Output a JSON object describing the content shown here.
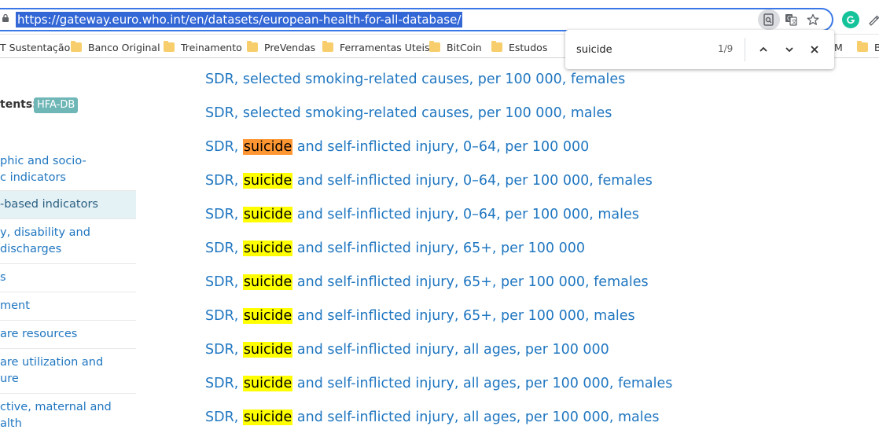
{
  "browser": {
    "url": "https://gateway.euro.who.int/en/datasets/european-health-for-all-database/",
    "icons": [
      "lock-icon",
      "find-in-page-icon",
      "translate-icon",
      "star-icon",
      "grammarly-icon",
      "extension-icon"
    ]
  },
  "bookmarks": [
    {
      "label": "T Sustentação"
    },
    {
      "label": "Banco Original"
    },
    {
      "label": "Treinamento"
    },
    {
      "label": "PreVendas"
    },
    {
      "label": "Ferramentas Uteis"
    },
    {
      "label": "BitCoin"
    },
    {
      "label": "Estudos"
    },
    {
      "label": "M"
    },
    {
      "label": "B"
    }
  ],
  "find": {
    "query": "suicide",
    "count": "1/9"
  },
  "sidebar": {
    "contents_label": "tents:",
    "badge": "HFA-DB",
    "items": [
      {
        "line1": "phic and socio-",
        "line2": "c indicators"
      },
      {
        "line1": "-based indicators",
        "line2": ""
      },
      {
        "line1": "y, disability and",
        "line2": "discharges"
      },
      {
        "line1": "s",
        "line2": ""
      },
      {
        "line1": "ment",
        "line2": ""
      },
      {
        "line1": "are resources",
        "line2": ""
      },
      {
        "line1": "are utilization and",
        "line2": "ure"
      },
      {
        "line1": "ctive, maternal and",
        "line2": "alth"
      }
    ]
  },
  "indicators": [
    {
      "pre": "SDR, selected smoking-related causes, per 100 000, females",
      "hl": "",
      "post": ""
    },
    {
      "pre": "SDR, selected smoking-related causes, per 100 000, males",
      "hl": "",
      "post": ""
    },
    {
      "pre": "SDR, ",
      "hl": "suicide",
      "post": " and self-inflicted injury, 0–64, per 100 000"
    },
    {
      "pre": "SDR, ",
      "hl": "suicide",
      "post": " and self-inflicted injury, 0–64, per 100 000, females"
    },
    {
      "pre": "SDR, ",
      "hl": "suicide",
      "post": " and self-inflicted injury, 0–64, per 100 000, males"
    },
    {
      "pre": "SDR, ",
      "hl": "suicide",
      "post": " and self-inflicted injury, 65+, per 100 000"
    },
    {
      "pre": "SDR, ",
      "hl": "suicide",
      "post": " and self-inflicted injury, 65+, per 100 000, females"
    },
    {
      "pre": "SDR, ",
      "hl": "suicide",
      "post": " and self-inflicted injury, 65+, per 100 000, males"
    },
    {
      "pre": "SDR, ",
      "hl": "suicide",
      "post": " and self-inflicted injury, all ages, per 100 000"
    },
    {
      "pre": "SDR, ",
      "hl": "suicide",
      "post": " and self-inflicted injury, all ages, per 100 000, females"
    },
    {
      "pre": "SDR, ",
      "hl": "suicide",
      "post": " and self-inflicted injury, all ages, per 100 000, males"
    }
  ],
  "colors": {
    "link": "#1f76c0",
    "highlight": "#ffff00",
    "current_highlight": "#ff9632",
    "badge": "#6fb6b6"
  }
}
